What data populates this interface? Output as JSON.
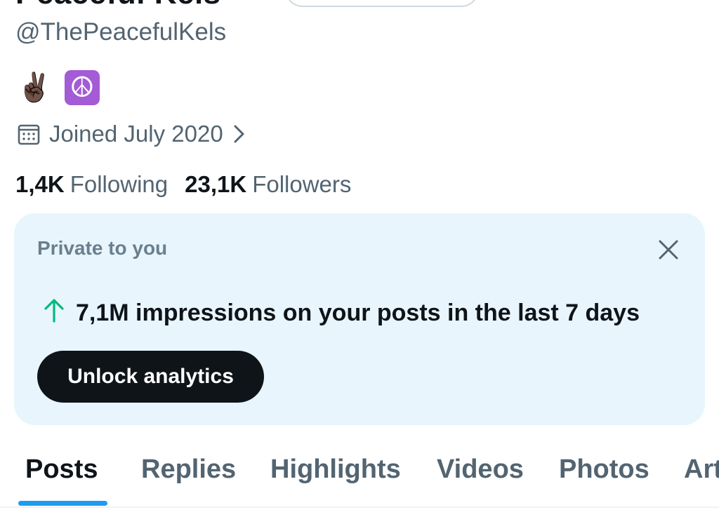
{
  "profile": {
    "display_name": "Peaceful Kels",
    "handle": "@ThePeacefulKels",
    "bio_emojis": [
      "✌🏿",
      "☮"
    ],
    "joined": "Joined July 2020",
    "following_count": "1,4K",
    "following_label": "Following",
    "followers_count": "23,1K",
    "followers_label": "Followers"
  },
  "analytics_card": {
    "title": "Private to you",
    "impressions_text": "7,1M impressions on your posts in the last 7 days",
    "button_label": "Unlock analytics",
    "background_color": "#e8f5fd",
    "arrow_color": "#00ba7c"
  },
  "tabs": [
    "Posts",
    "Replies",
    "Highlights",
    "Videos",
    "Photos",
    "Articles"
  ],
  "active_tab": "Posts",
  "accent_color": "#1d9bf0",
  "icons": {
    "calendar": "calendar-icon",
    "chevron": "chevron-right-icon",
    "close": "close-icon",
    "arrow": "arrow-up-icon"
  }
}
